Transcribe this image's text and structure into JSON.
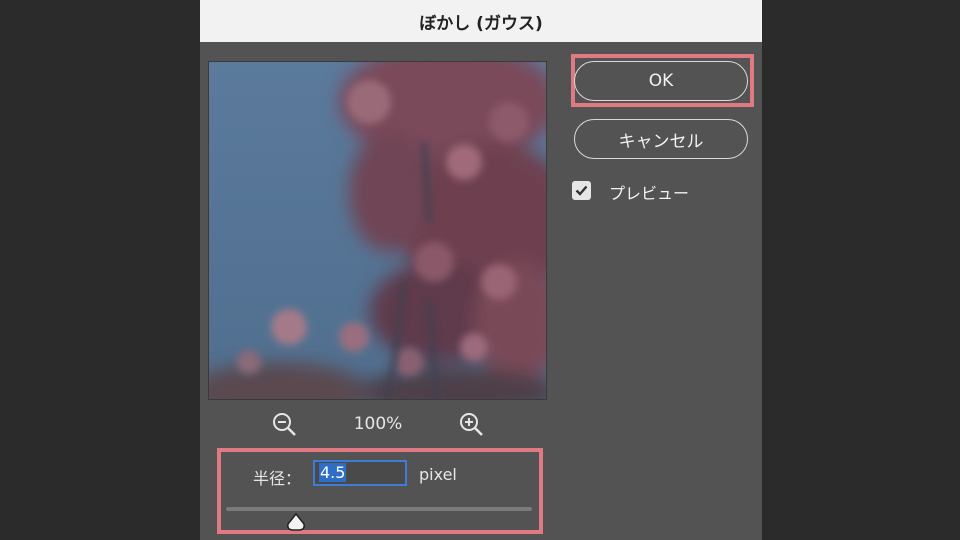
{
  "dialog": {
    "title": "ぼかし (ガウス)",
    "ok_label": "OK",
    "cancel_label": "キャンセル",
    "preview_label": "プレビュー",
    "preview_checked": true
  },
  "zoom": {
    "level": "100%",
    "zoom_out_icon": "zoom-out-magnifier",
    "zoom_in_icon": "zoom-in-magnifier"
  },
  "radius": {
    "label": "半径：",
    "value": "4.5",
    "unit": "pixel",
    "slider_fraction": 0.23
  },
  "colors": {
    "highlight": "#e07a82",
    "selection": "#2f6ec7",
    "dialog_bg": "#535353"
  }
}
